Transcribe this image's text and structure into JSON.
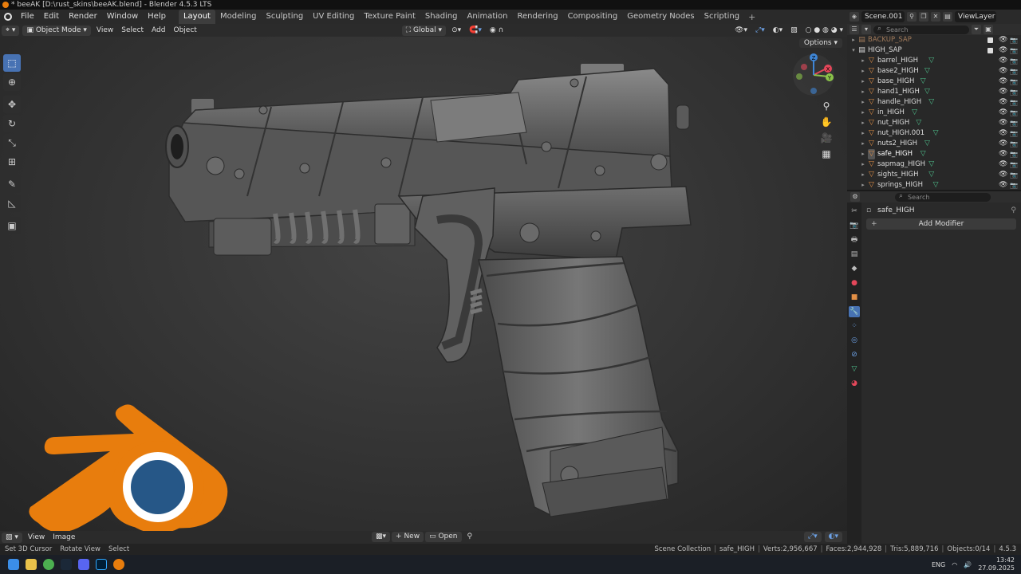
{
  "window": {
    "title": "* beeAK [D:\\rust_skins\\beeAK.blend] - Blender 4.5.3 LTS"
  },
  "menu": [
    "File",
    "Edit",
    "Render",
    "Window",
    "Help"
  ],
  "workspaces": [
    {
      "label": "Layout",
      "active": true
    },
    {
      "label": "Modeling"
    },
    {
      "label": "Sculpting"
    },
    {
      "label": "UV Editing"
    },
    {
      "label": "Texture Paint"
    },
    {
      "label": "Shading"
    },
    {
      "label": "Animation"
    },
    {
      "label": "Rendering"
    },
    {
      "label": "Compositing"
    },
    {
      "label": "Geometry Nodes"
    },
    {
      "label": "Scripting"
    }
  ],
  "scene": {
    "name": "Scene.001",
    "view_layer": "ViewLayer"
  },
  "viewport_header": {
    "mode": "Object Mode",
    "menus": [
      "View",
      "Select",
      "Add",
      "Object"
    ],
    "transform_orientation": "Global",
    "options_label": "Options"
  },
  "outliner": {
    "search_placeholder": "Search",
    "rows": [
      {
        "label": "BACKUP_SAP",
        "level": 0,
        "dim": true,
        "collection": true
      },
      {
        "label": "HIGH_SAP",
        "level": 0,
        "collection": true,
        "expanded": true
      },
      {
        "label": "barrel_HIGH",
        "level": 1
      },
      {
        "label": "base2_HIGH",
        "level": 1
      },
      {
        "label": "base_HIGH",
        "level": 1
      },
      {
        "label": "hand1_HIGH",
        "level": 1
      },
      {
        "label": "handle_HIGH",
        "level": 1
      },
      {
        "label": "in_HIGH",
        "level": 1
      },
      {
        "label": "nut_HIGH",
        "level": 1
      },
      {
        "label": "nut_HIGH.001",
        "level": 1
      },
      {
        "label": "nuts2_HIGH",
        "level": 1
      },
      {
        "label": "safe_HIGH",
        "level": 1,
        "selected": true
      },
      {
        "label": "sapmag_HIGH",
        "level": 1
      },
      {
        "label": "sights_HIGH",
        "level": 1
      },
      {
        "label": "springs_HIGH",
        "level": 1
      }
    ]
  },
  "properties": {
    "search_placeholder": "Search",
    "object_name": "safe_HIGH",
    "add_modifier_label": "Add Modifier"
  },
  "image_editor": {
    "menus": [
      "View",
      "Image"
    ],
    "new_label": "New",
    "open_label": "Open"
  },
  "status_bar": {
    "left": [
      "Set 3D Cursor",
      "Rotate View",
      "Select"
    ],
    "right": [
      "Scene Collection",
      "safe_HIGH",
      "Verts:2,956,667",
      "Faces:2,944,928",
      "Tris:5,889,716",
      "Objects:0/14",
      "4.5.3"
    ]
  },
  "taskbar": {
    "language": "ENG",
    "time": "13:42",
    "date": "27.09.2025"
  },
  "gizmo_axes": {
    "x": "X",
    "y": "Y",
    "z": "Z"
  },
  "colors": {
    "accent_blue": "#4772b3",
    "blender_orange": "#e87d0d",
    "blender_blue": "#265787",
    "mesh_green": "#4fc08d"
  }
}
